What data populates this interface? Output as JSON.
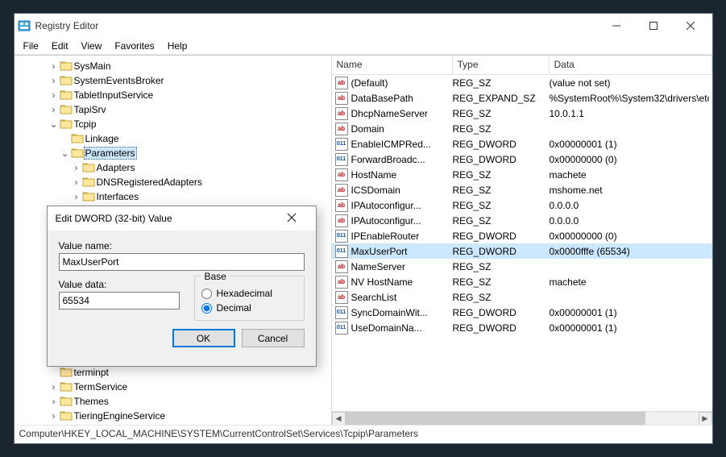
{
  "window": {
    "title": "Registry Editor"
  },
  "menubar": [
    "File",
    "Edit",
    "View",
    "Favorites",
    "Help"
  ],
  "tree": {
    "items": [
      {
        "indent": 3,
        "twist": ">",
        "label": "SysMain"
      },
      {
        "indent": 3,
        "twist": ">",
        "label": "SystemEventsBroker"
      },
      {
        "indent": 3,
        "twist": ">",
        "label": "TabletInputService"
      },
      {
        "indent": 3,
        "twist": ">",
        "label": "TapiSrv"
      },
      {
        "indent": 3,
        "twist": "v",
        "label": "Tcpip"
      },
      {
        "indent": 4,
        "twist": "",
        "label": "Linkage"
      },
      {
        "indent": 4,
        "twist": "v",
        "label": "Parameters",
        "selected": true
      },
      {
        "indent": 5,
        "twist": ">",
        "label": "Adapters"
      },
      {
        "indent": 5,
        "twist": ">",
        "label": "DNSRegisteredAdapters"
      },
      {
        "indent": 5,
        "twist": ">",
        "label": "Interfaces"
      }
    ],
    "tail_items": [
      {
        "indent": 3,
        "twist": "",
        "label": "terminpt"
      },
      {
        "indent": 3,
        "twist": ">",
        "label": "TermService"
      },
      {
        "indent": 3,
        "twist": ">",
        "label": "Themes"
      },
      {
        "indent": 3,
        "twist": ">",
        "label": "TieringEngineService"
      }
    ]
  },
  "list": {
    "columns": [
      "Name",
      "Type",
      "Data"
    ],
    "rows": [
      {
        "icon": "str",
        "name": "(Default)",
        "type": "REG_SZ",
        "data": "(value not set)"
      },
      {
        "icon": "str",
        "name": "DataBasePath",
        "type": "REG_EXPAND_SZ",
        "data": "%SystemRoot%\\System32\\drivers\\etc"
      },
      {
        "icon": "str",
        "name": "DhcpNameServer",
        "type": "REG_SZ",
        "data": "10.0.1.1"
      },
      {
        "icon": "str",
        "name": "Domain",
        "type": "REG_SZ",
        "data": ""
      },
      {
        "icon": "bin",
        "name": "EnableICMPRed...",
        "type": "REG_DWORD",
        "data": "0x00000001 (1)"
      },
      {
        "icon": "bin",
        "name": "ForwardBroadc...",
        "type": "REG_DWORD",
        "data": "0x00000000 (0)"
      },
      {
        "icon": "str",
        "name": "HostName",
        "type": "REG_SZ",
        "data": "machete"
      },
      {
        "icon": "str",
        "name": "ICSDomain",
        "type": "REG_SZ",
        "data": "mshome.net"
      },
      {
        "icon": "str",
        "name": "IPAutoconfigur...",
        "type": "REG_SZ",
        "data": "0.0.0.0"
      },
      {
        "icon": "str",
        "name": "IPAutoconfigur...",
        "type": "REG_SZ",
        "data": "0.0.0.0"
      },
      {
        "icon": "bin",
        "name": "IPEnableRouter",
        "type": "REG_DWORD",
        "data": "0x00000000 (0)"
      },
      {
        "icon": "bin",
        "name": "MaxUserPort",
        "type": "REG_DWORD",
        "data": "0x0000fffe (65534)",
        "selected": true
      },
      {
        "icon": "str",
        "name": "NameServer",
        "type": "REG_SZ",
        "data": ""
      },
      {
        "icon": "str",
        "name": "NV HostName",
        "type": "REG_SZ",
        "data": "machete"
      },
      {
        "icon": "str",
        "name": "SearchList",
        "type": "REG_SZ",
        "data": ""
      },
      {
        "icon": "bin",
        "name": "SyncDomainWit...",
        "type": "REG_DWORD",
        "data": "0x00000001 (1)"
      },
      {
        "icon": "bin",
        "name": "UseDomainNa...",
        "type": "REG_DWORD",
        "data": "0x00000001 (1)"
      }
    ]
  },
  "dialog": {
    "title": "Edit DWORD (32-bit) Value",
    "value_name_label": "Value name:",
    "value_name": "MaxUserPort",
    "value_data_label": "Value data:",
    "value_data": "65534",
    "base_label": "Base",
    "hex_label": "Hexadecimal",
    "dec_label": "Decimal",
    "ok": "OK",
    "cancel": "Cancel"
  },
  "statusbar": "Computer\\HKEY_LOCAL_MACHINE\\SYSTEM\\CurrentControlSet\\Services\\Tcpip\\Parameters"
}
